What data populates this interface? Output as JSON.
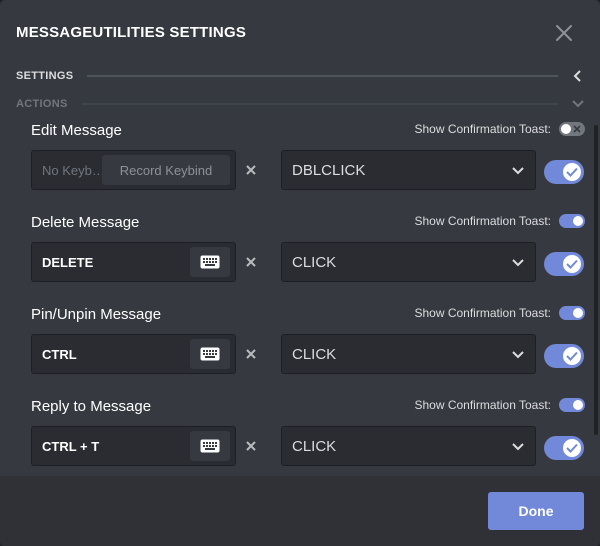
{
  "modal": {
    "title": "MESSAGEUTILITIES SETTINGS",
    "close_icon": "close-icon"
  },
  "sections": [
    {
      "label": "SETTINGS",
      "label_color": "#dcddde",
      "line_color": "#4f545c",
      "chevron": "chevron-left-icon"
    },
    {
      "label": "ACTIONS",
      "label_color": "#72767d",
      "line_color": "#40444b",
      "chevron": "chevron-down-icon"
    }
  ],
  "toast_label": "Show Confirmation Toast:",
  "actions": [
    {
      "title": "Edit Message",
      "toast_on": false,
      "keybind": {
        "placeholder": "No Keyb…",
        "record_label": "Record Keybind",
        "value": ""
      },
      "event": "DBLCLICK",
      "enabled": true
    },
    {
      "title": "Delete Message",
      "toast_on": true,
      "keybind": {
        "value": "DELETE"
      },
      "event": "CLICK",
      "enabled": true
    },
    {
      "title": "Pin/Unpin Message",
      "toast_on": true,
      "keybind": {
        "value": "CTRL"
      },
      "event": "CLICK",
      "enabled": true
    },
    {
      "title": "Reply to Message",
      "toast_on": true,
      "keybind": {
        "value": "CTRL + T"
      },
      "event": "CLICK",
      "enabled": true
    }
  ],
  "footer": {
    "done_label": "Done"
  },
  "colors": {
    "accent": "#7289da",
    "toggle_off": "#72767d"
  }
}
